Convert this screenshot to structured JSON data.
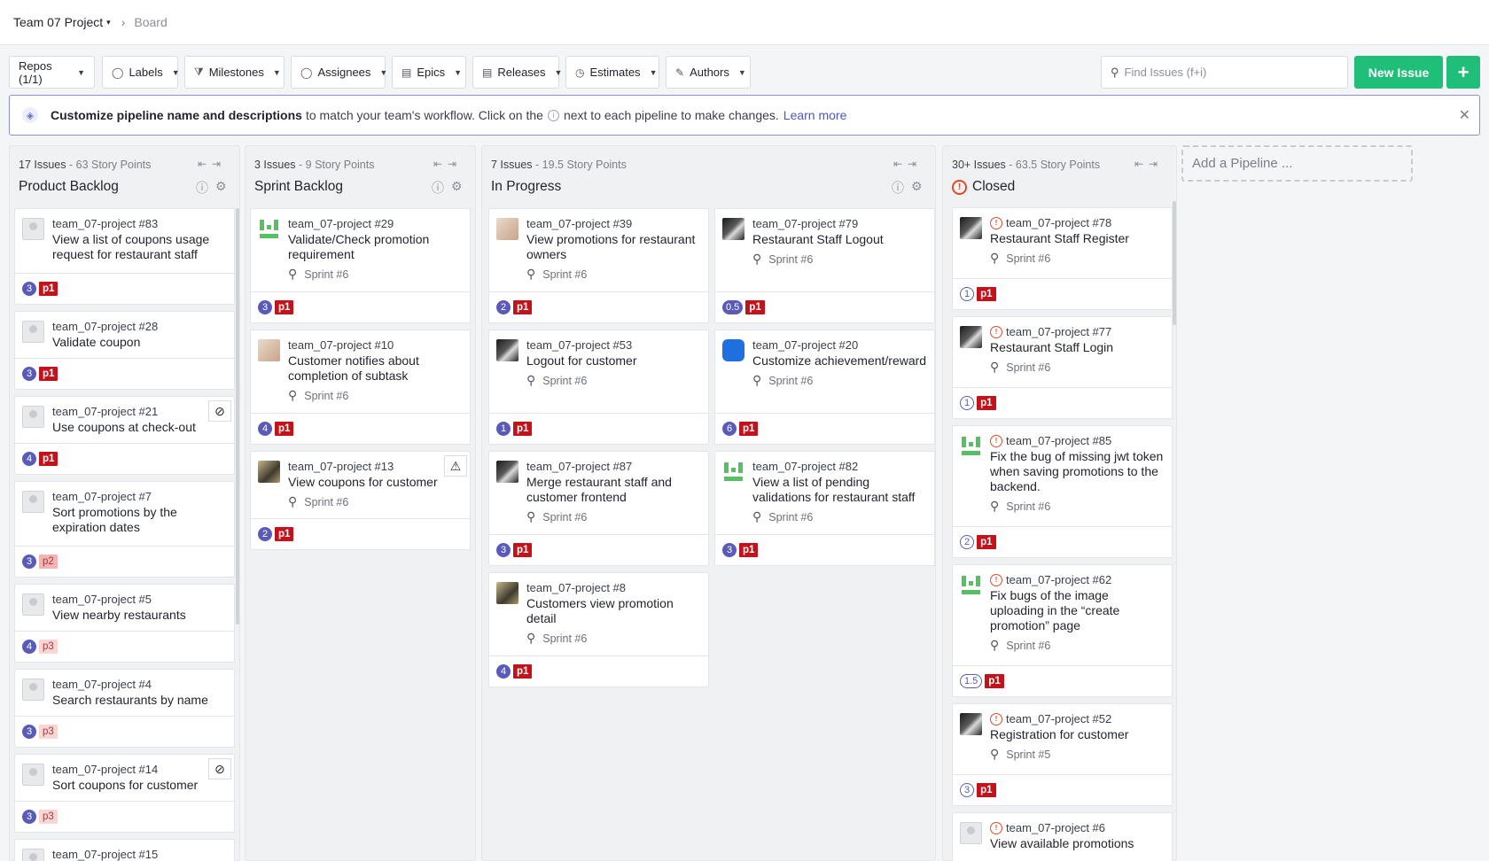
{
  "breadcrumb": {
    "project": "Team 07 Project",
    "page": "Board"
  },
  "filters": [
    {
      "label": "Repos (1/1)",
      "icon": ""
    },
    {
      "label": "Labels",
      "icon": "tag-icon"
    },
    {
      "label": "Milestones",
      "icon": "signpost-icon"
    },
    {
      "label": "Assignees",
      "icon": "person-icon"
    },
    {
      "label": "Epics",
      "icon": "document-icon"
    },
    {
      "label": "Releases",
      "icon": "document-icon"
    },
    {
      "label": "Estimates",
      "icon": "timer-icon"
    },
    {
      "label": "Authors",
      "icon": "pen-icon"
    }
  ],
  "search": {
    "placeholder": "Find Issues (f+i)"
  },
  "new_issue": "New Issue",
  "plus": "+",
  "banner": {
    "bold": "Customize pipeline name and descriptions",
    "text1": "to match your team's workflow. Click on the",
    "text2": "next to each pipeline to make changes.",
    "link": "Learn more"
  },
  "add_pipeline": "Add a Pipeline ...",
  "pipelines": [
    {
      "name": "Product Backlog",
      "count": "17 Issues",
      "points": " - 63 Story Points",
      "cards": [
        {
          "repo": "team_07-project #83",
          "title": "View a list of coupons usage request for restaurant staff",
          "est": "3",
          "label": "p1"
        },
        {
          "repo": "team_07-project #28",
          "title": "Validate coupon",
          "est": "3",
          "label": "p1"
        },
        {
          "repo": "team_07-project #21",
          "title": "Use coupons at check-out",
          "est": "4",
          "label": "p1"
        },
        {
          "repo": "team_07-project #7",
          "title": "Sort promotions by the expiration dates",
          "est": "3",
          "label": "p2"
        },
        {
          "repo": "team_07-project #5",
          "title": "View nearby restaurants",
          "est": "4",
          "label": "p3"
        },
        {
          "repo": "team_07-project #4",
          "title": "Search restaurants by name",
          "est": "3",
          "label": "p3"
        },
        {
          "repo": "team_07-project #14",
          "title": "Sort coupons for customer",
          "est": "3",
          "label": "p3"
        },
        {
          "repo": "team_07-project #15",
          "title": "",
          "est": "",
          "label": ""
        }
      ]
    },
    {
      "name": "Sprint Backlog",
      "count": "3 Issues",
      "points": " - 9 Story Points",
      "cards": [
        {
          "repo": "team_07-project #29",
          "title": "Validate/Check promotion requirement",
          "sprint": "Sprint #6",
          "est": "3",
          "label": "p1"
        },
        {
          "repo": "team_07-project #10",
          "title": "Customer notifies about completion of subtask",
          "sprint": "Sprint #6",
          "est": "4",
          "label": "p1"
        },
        {
          "repo": "team_07-project #13",
          "title": "View coupons for customer",
          "sprint": "Sprint #6",
          "est": "2",
          "label": "p1"
        }
      ]
    },
    {
      "name": "In Progress",
      "count": "7 Issues",
      "points": " - 19.5 Story Points",
      "cards": [
        {
          "repo": "team_07-project #39",
          "title": "View promotions for restaurant owners",
          "sprint": "Sprint #6",
          "est": "2",
          "label": "p1"
        },
        {
          "repo": "team_07-project #79",
          "title": "Restaurant Staff Logout",
          "sprint": "Sprint #6",
          "est": "0.5",
          "label": "p1"
        },
        {
          "repo": "team_07-project #53",
          "title": "Logout for customer",
          "sprint": "Sprint #6",
          "est": "1",
          "label": "p1"
        },
        {
          "repo": "team_07-project #20",
          "title": "Customize achievement/reward",
          "sprint": "Sprint #6",
          "est": "6",
          "label": "p1"
        },
        {
          "repo": "team_07-project #87",
          "title": "Merge restaurant staff and customer frontend",
          "sprint": "Sprint #6",
          "est": "3",
          "label": "p1"
        },
        {
          "repo": "team_07-project #82",
          "title": "View a list of pending validations for restaurant staff",
          "sprint": "Sprint #6",
          "est": "3",
          "label": "p1"
        },
        {
          "repo": "team_07-project #8",
          "title": "Customers view promotion detail",
          "sprint": "Sprint #6",
          "est": "4",
          "label": "p1"
        }
      ]
    },
    {
      "name": "Closed",
      "count": "30+ Issues",
      "points": " - 63.5 Story Points",
      "cards": [
        {
          "repo": "team_07-project #78",
          "title": "Restaurant Staff Register",
          "sprint": "Sprint #6",
          "est": "1",
          "label": "p1"
        },
        {
          "repo": "team_07-project #77",
          "title": "Restaurant Staff Login",
          "sprint": "Sprint #6",
          "est": "1",
          "label": "p1"
        },
        {
          "repo": "team_07-project #85",
          "title": "Fix the bug of missing jwt token when saving promotions to the backend.",
          "sprint": "Sprint #6",
          "est": "2",
          "label": "p1"
        },
        {
          "repo": "team_07-project #62",
          "title": "Fix bugs of the image uploading in the “create promotion” page",
          "sprint": "Sprint #6",
          "est": "1.5",
          "label": "p1"
        },
        {
          "repo": "team_07-project #52",
          "title": "Registration for customer",
          "sprint": "Sprint #5",
          "est": "3",
          "label": "p1"
        },
        {
          "repo": "team_07-project #6",
          "title": "View available promotions",
          "sprint": "",
          "est": "",
          "label": ""
        }
      ]
    }
  ]
}
